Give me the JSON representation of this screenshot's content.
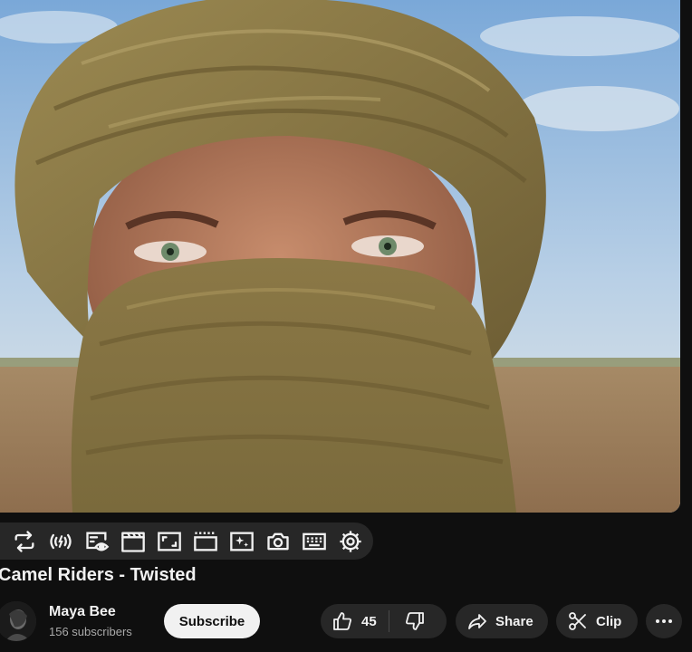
{
  "toolbar": {
    "buttons": [
      {
        "icon": "loop-icon"
      },
      {
        "icon": "broadcast-icon"
      },
      {
        "icon": "mini-view-icon"
      },
      {
        "icon": "cinema-icon"
      },
      {
        "icon": "resize-icon"
      },
      {
        "icon": "frame-by-frame-icon"
      },
      {
        "icon": "screen-filter-icon"
      },
      {
        "icon": "camera-icon"
      },
      {
        "icon": "keyboard-icon"
      },
      {
        "icon": "gear-icon"
      }
    ]
  },
  "video": {
    "title": "Camel Riders - Twisted"
  },
  "channel": {
    "name": "Maya Bee",
    "subscribers": "156 subscribers",
    "subscribe_label": "Subscribe"
  },
  "actions": {
    "like_count": "45",
    "share_label": "Share",
    "clip_label": "Clip",
    "more_label": "⋯"
  },
  "colors": {
    "background": "#0f0f0f",
    "pill": "#272727",
    "text": "#f1f1f1",
    "secondary_text": "#aaaaaa",
    "subscribe_bg": "#f1f1f1"
  }
}
